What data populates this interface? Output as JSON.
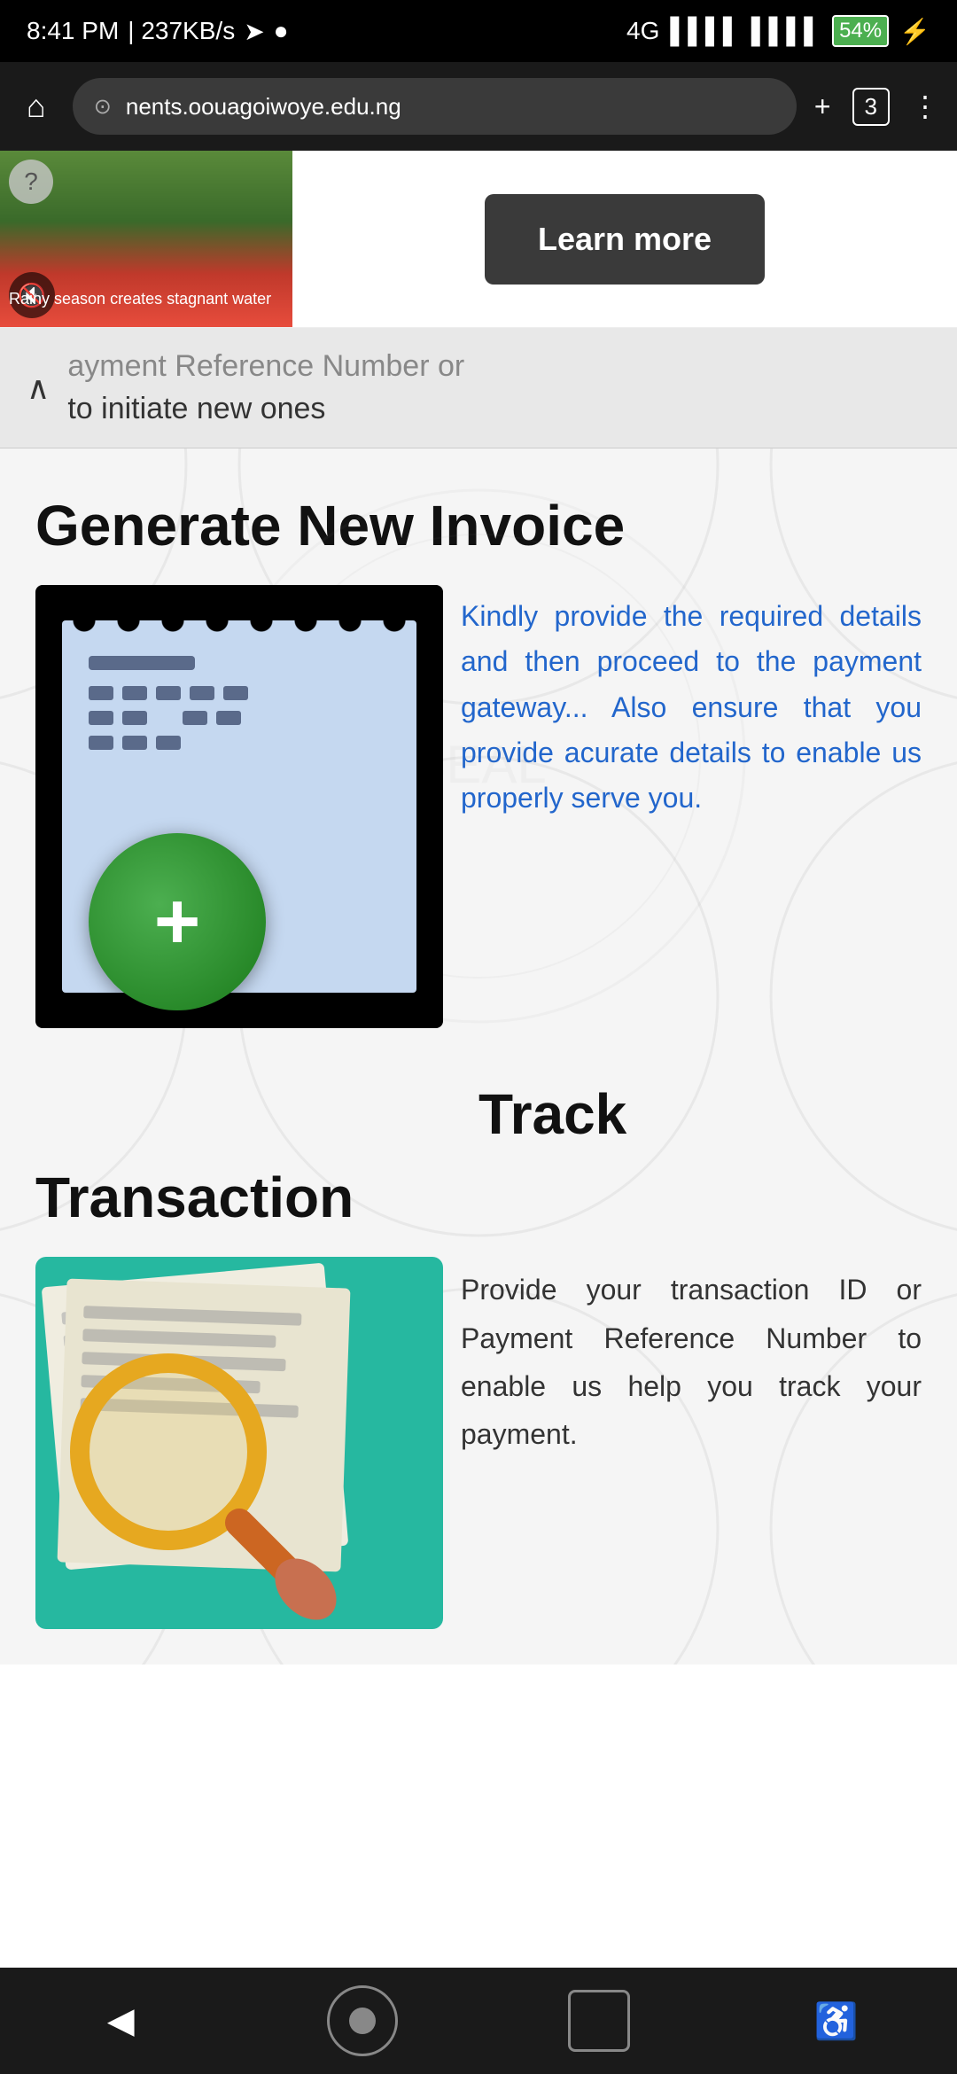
{
  "statusBar": {
    "time": "8:41 PM",
    "network": "237KB/s",
    "sim1": "4G",
    "battery": "54"
  },
  "browserBar": {
    "url": "nents.oouagoiwoye.edu.ng",
    "tabCount": "3"
  },
  "adBanner": {
    "questionMark": "?",
    "muteIcon": "🔇",
    "adText": "Rainy season creates stagnant water",
    "learnMoreLabel": "Learn more"
  },
  "collapsedSection": {
    "partialTitle": "ayment Reference Number or",
    "subtitle": "to initiate new ones"
  },
  "generateSection": {
    "title": "Generate New Invoice",
    "description": "Kindly provide the required details and then proceed to the payment gateway... Also ensure that you provide acurate details to enable us properly serve you."
  },
  "trackSection": {
    "title": "Track",
    "transactionLabel": "Transaction",
    "description": "Provide your transaction ID or Payment Reference Number to enable us help you track your payment."
  },
  "bottomNav": {
    "backLabel": "◀",
    "homeLabel": "⬤",
    "squareLabel": "□",
    "accessibilityLabel": "♿"
  }
}
